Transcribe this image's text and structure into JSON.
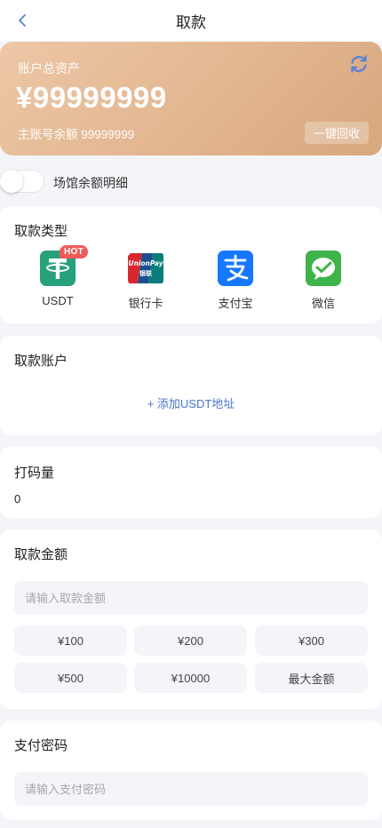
{
  "nav": {
    "title": "取款",
    "back_icon": "chevron-left-icon"
  },
  "balance": {
    "label": "账户总资产",
    "amount": "¥99999999",
    "sub_label": "主账号余额 99999999",
    "recycle_label": "一键回收",
    "refresh_icon": "refresh-icon",
    "gradient_start": "#edc7a6",
    "gradient_end": "#d7a77d"
  },
  "venue_toggle": {
    "label": "场馆余额明细",
    "on": false
  },
  "withdraw_type": {
    "title": "取款类型",
    "items": [
      {
        "name": "USDT",
        "badge": "HOT",
        "icon": "usdt-icon",
        "color": "#26a17b"
      },
      {
        "name": "银行卡",
        "icon": "unionpay-icon",
        "color": "#d7282f"
      },
      {
        "name": "支付宝",
        "icon": "alipay-icon",
        "color": "#1677ff"
      },
      {
        "name": "微信",
        "icon": "wechat-icon",
        "color": "#3fb44a"
      }
    ]
  },
  "account": {
    "title": "取款账户",
    "add_label": "+ 添加USDT地址"
  },
  "bet_code": {
    "title": "打码量",
    "value": "0"
  },
  "amount": {
    "title": "取款金额",
    "placeholder": "请输入取款金额",
    "options": [
      "¥100",
      "¥200",
      "¥300",
      "¥500",
      "¥10000",
      "最大金额"
    ]
  },
  "password": {
    "title": "支付密码",
    "placeholder": "请输入支付密码"
  },
  "colors": {
    "link": "#4a74c9",
    "refresh": "#5b84d6",
    "hot_badge": "#ef5b5b"
  }
}
